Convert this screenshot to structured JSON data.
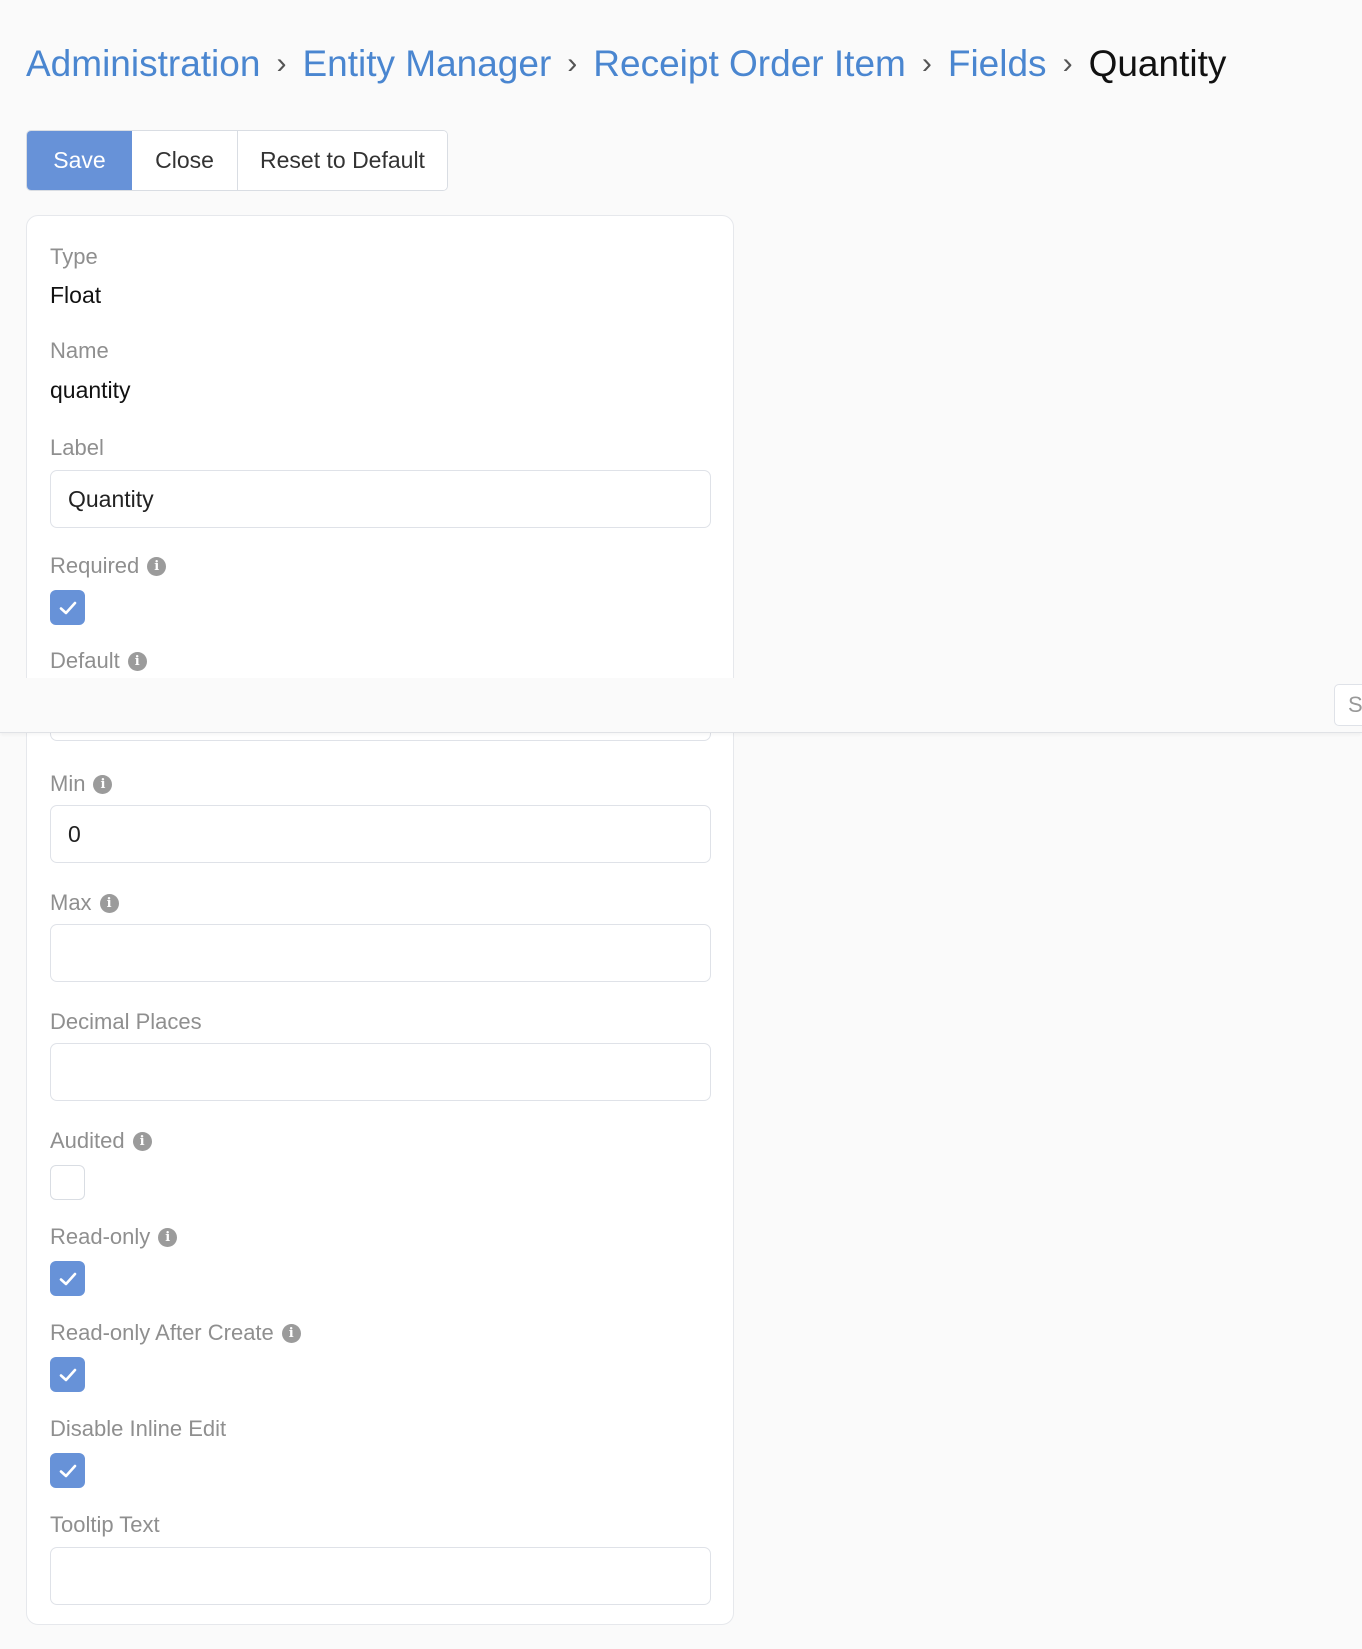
{
  "breadcrumb": {
    "items": [
      "Administration",
      "Entity Manager",
      "Receipt Order Item",
      "Fields"
    ],
    "current": "Quantity",
    "separator": "›"
  },
  "toolbar": {
    "save_label": "Save",
    "close_label": "Close",
    "reset_label": "Reset to Default"
  },
  "fields": {
    "type": {
      "label": "Type",
      "value": "Float"
    },
    "name": {
      "label": "Name",
      "value": "quantity"
    },
    "label": {
      "label": "Label",
      "value": "Quantity"
    },
    "required": {
      "label": "Required",
      "checked": true
    },
    "default": {
      "label": "Default",
      "value": ""
    },
    "min": {
      "label": "Min",
      "value": "0"
    },
    "max": {
      "label": "Max",
      "value": ""
    },
    "decimal_places": {
      "label": "Decimal Places",
      "value": ""
    },
    "audited": {
      "label": "Audited",
      "checked": false
    },
    "read_only": {
      "label": "Read-only",
      "checked": true
    },
    "read_only_after_create": {
      "label": "Read-only After Create",
      "checked": true
    },
    "disable_inline_edit": {
      "label": "Disable Inline Edit",
      "checked": true
    },
    "tooltip_text": {
      "label": "Tooltip Text",
      "value": ""
    }
  },
  "overlay": {
    "input_text": "S"
  },
  "icons": {
    "info": "info-icon",
    "check": "check-icon"
  },
  "colors": {
    "accent": "#6792d8",
    "link": "#4a86d0",
    "label": "#8f8f8f",
    "background": "#fafafa"
  }
}
